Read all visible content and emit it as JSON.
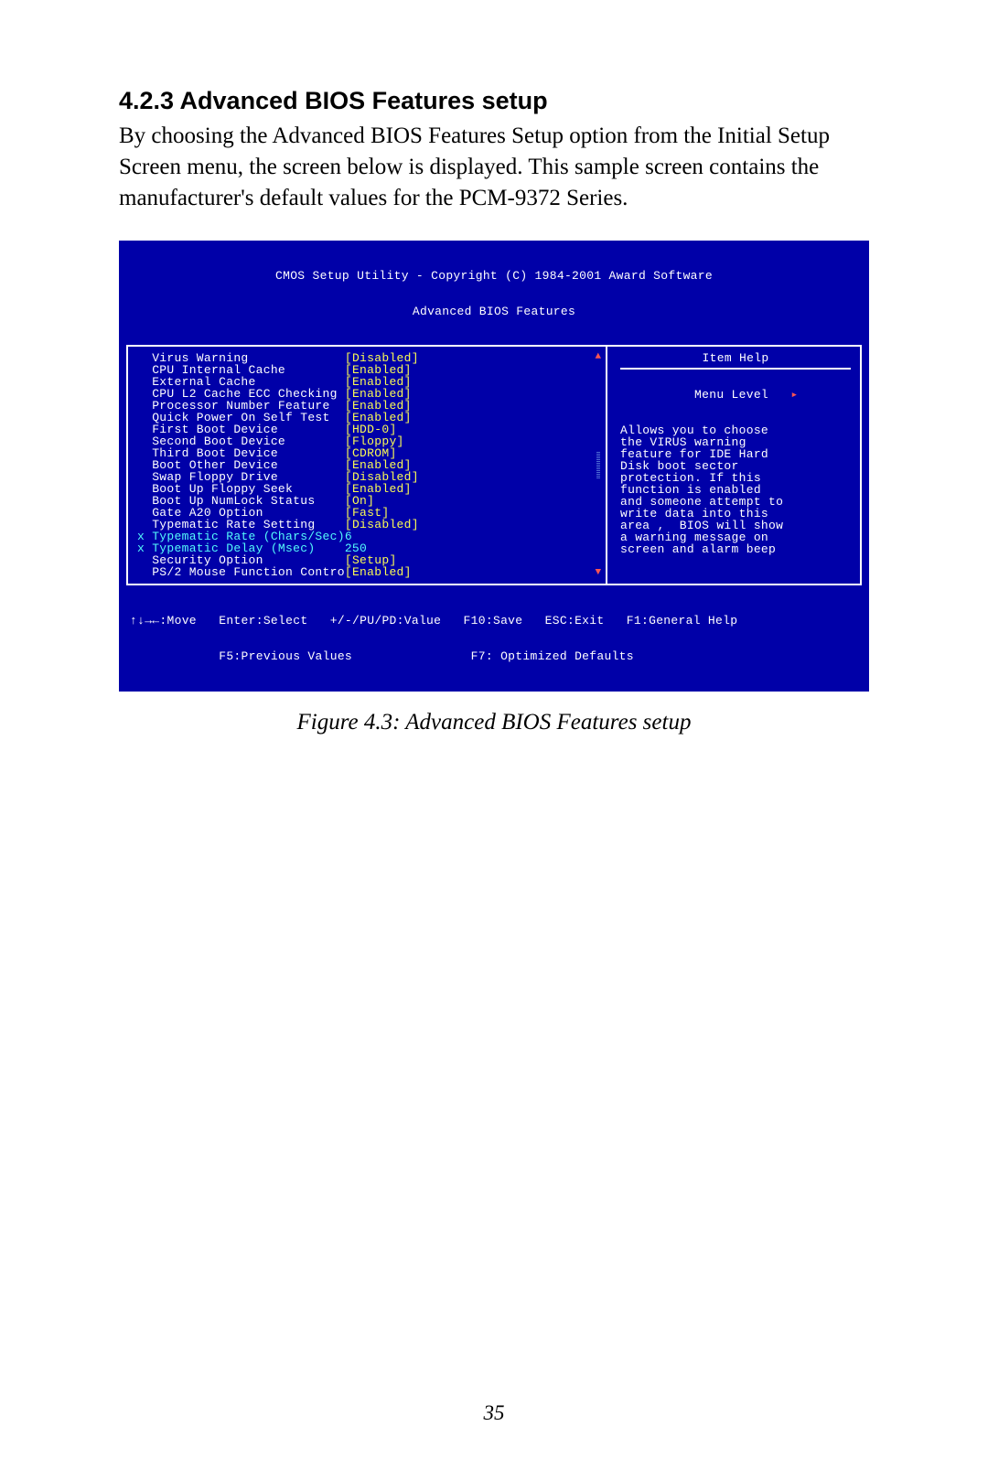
{
  "heading": "4.2.3 Advanced BIOS Features setup",
  "paragraph": "By choosing the Advanced BIOS Features Setup option from the Initial Setup Screen menu, the screen below is displayed. This sample screen contains the manufacturer's default values for the PCM-9372 Series.",
  "bios": {
    "title_line1": "CMOS Setup Utility - Copyright (C) 1984-2001 Award Software",
    "title_line2": "Advanced BIOS Features",
    "settings": [
      {
        "label": "Virus Warning",
        "value": "[Disabled]",
        "style": "yellow-value",
        "prefix": "  "
      },
      {
        "label": "CPU Internal Cache",
        "value": "[Enabled]",
        "style": "yellow-value",
        "prefix": "  "
      },
      {
        "label": "External Cache",
        "value": "[Enabled]",
        "style": "yellow-value",
        "prefix": "  "
      },
      {
        "label": "CPU L2 Cache ECC Checking",
        "value": "[Enabled]",
        "style": "yellow-value",
        "prefix": "  "
      },
      {
        "label": "Processor Number Feature",
        "value": "[Enabled]",
        "style": "yellow-value",
        "prefix": "  "
      },
      {
        "label": "Quick Power On Self Test",
        "value": "[Enabled]",
        "style": "yellow-value",
        "prefix": "  "
      },
      {
        "label": "First Boot Device",
        "value": "[HDD-0]",
        "style": "yellow-value",
        "prefix": "  "
      },
      {
        "label": "Second Boot Device",
        "value": "[Floppy]",
        "style": "yellow-value",
        "prefix": "  "
      },
      {
        "label": "Third Boot Device",
        "value": "[CDROM]",
        "style": "yellow-value",
        "prefix": "  "
      },
      {
        "label": "Boot Other Device",
        "value": "[Enabled]",
        "style": "yellow-value",
        "prefix": "  "
      },
      {
        "label": "Swap Floppy Drive",
        "value": "[Disabled]",
        "style": "yellow-value",
        "prefix": "  "
      },
      {
        "label": "Boot Up Floppy Seek",
        "value": "[Enabled]",
        "style": "yellow-value",
        "prefix": "  "
      },
      {
        "label": "Boot Up NumLock Status",
        "value": "[On]",
        "style": "yellow-value",
        "prefix": "  "
      },
      {
        "label": "Gate A20 Option",
        "value": "[Fast]",
        "style": "yellow-value",
        "prefix": "  "
      },
      {
        "label": "Typematic Rate Setting",
        "value": "[Disabled]",
        "style": "yellow-value",
        "prefix": "  "
      },
      {
        "label": "Typematic Rate (Chars/Sec)",
        "value": "6",
        "style": "cyan-all",
        "prefix": "x "
      },
      {
        "label": "Typematic Delay (Msec)",
        "value": "250",
        "style": "cyan-all",
        "prefix": "x "
      },
      {
        "label": "Security Option",
        "value": "[Setup]",
        "style": "yellow-value",
        "prefix": "  "
      },
      {
        "label": "PS/2 Mouse Function Contro",
        "value": "[Enabled]",
        "style": "yellow-value",
        "prefix": "  ",
        "nosep": true
      }
    ],
    "help": {
      "title": "Item Help",
      "menu_level": "Menu Level   ",
      "menu_level_arrow": "▸",
      "lines": [
        "Allows you to choose",
        "the VIRUS warning",
        "feature for IDE Hard",
        "Disk boot sector",
        "protection. If this",
        "function is enabled",
        "and someone attempt to",
        "write data into this",
        "area ,  BIOS will show",
        "a warning message on",
        "screen and alarm beep"
      ]
    },
    "footer_line1": "↑↓→←:Move   Enter:Select   +/-/PU/PD:Value   F10:Save   ESC:Exit   F1:General Help",
    "footer_line2": "            F5:Previous Values                F7: Optimized Defaults"
  },
  "figure_caption": "Figure 4.3: Advanced BIOS Features setup",
  "page_number": "35"
}
